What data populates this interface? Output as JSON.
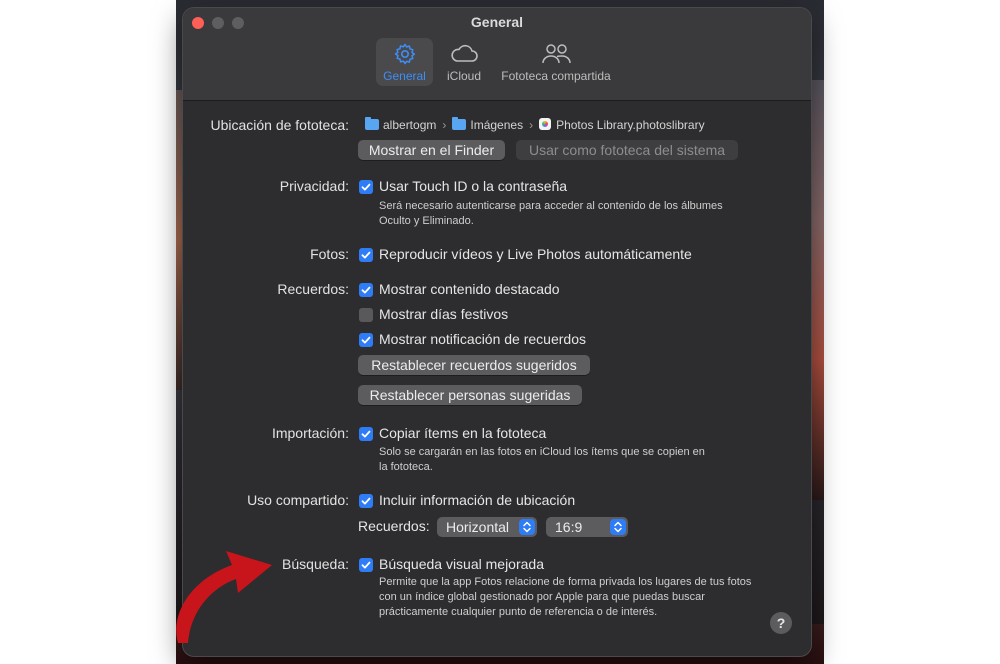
{
  "window": {
    "title": "General"
  },
  "tabs": [
    {
      "label": "General",
      "icon": "gear-icon",
      "active": true
    },
    {
      "label": "iCloud",
      "icon": "cloud-icon",
      "active": false
    },
    {
      "label": "Fototeca compartida",
      "icon": "people-icon",
      "active": false
    }
  ],
  "library": {
    "label": "Ubicación de fototeca:",
    "path": [
      "albertogm",
      "Imágenes",
      "Photos Library.photoslibrary"
    ],
    "show_in_finder": "Mostrar en el Finder",
    "use_as_system": "Usar como fototeca del sistema"
  },
  "privacy": {
    "label": "Privacidad:",
    "touch_id": {
      "text": "Usar Touch ID o la contraseña",
      "checked": true
    },
    "description": "Será necesario autenticarse para acceder al contenido de los álbumes Oculto y Eliminado."
  },
  "photos": {
    "label": "Fotos:",
    "autoplay": {
      "text": "Reproducir vídeos y Live Photos automáticamente",
      "checked": true
    }
  },
  "memories": {
    "label": "Recuerdos:",
    "featured": {
      "text": "Mostrar contenido destacado",
      "checked": true
    },
    "holidays": {
      "text": "Mostrar días festivos",
      "checked": false
    },
    "notifications": {
      "text": "Mostrar notificación de recuerdos",
      "checked": true
    },
    "reset_memories": "Restablecer recuerdos sugeridos",
    "reset_people": "Restablecer personas sugeridas"
  },
  "import": {
    "label": "Importación:",
    "copy": {
      "text": "Copiar ítems en la fototeca",
      "checked": true
    },
    "description": "Solo se cargarán en las fotos en iCloud los ítems que se copien en la fototeca."
  },
  "sharing": {
    "label": "Uso compartido:",
    "location": {
      "text": "Incluir información de ubicación",
      "checked": true
    },
    "memories_label": "Recuerdos:",
    "orientation": "Horizontal",
    "ratio": "16:9"
  },
  "search": {
    "label": "Búsqueda:",
    "visual": {
      "text": "Búsqueda visual mejorada",
      "checked": true
    },
    "description": "Permite que la app Fotos relacione de forma privada los lugares de tus fotos con un índice global gestionado por Apple para que puedas buscar prácticamente cualquier punto de referencia o de interés."
  },
  "help": "?",
  "colors": {
    "accent": "#2e7cf6",
    "arrow": "#c8151b",
    "window_bg": "#2d2c2e",
    "close": "#ff5f57"
  }
}
